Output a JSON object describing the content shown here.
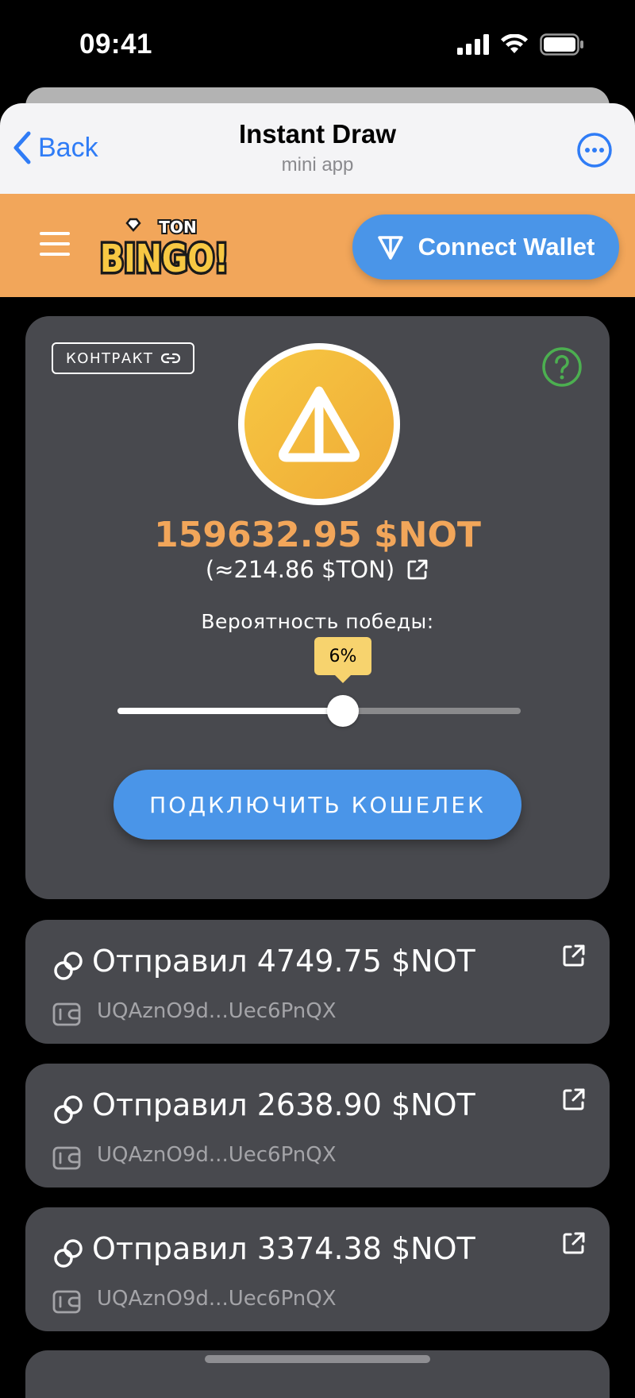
{
  "status_bar": {
    "time": "09:41",
    "icons": [
      "cellular-signal-icon",
      "wifi-icon",
      "battery-icon"
    ]
  },
  "nav": {
    "back_label": "Back",
    "title": "Instant Draw",
    "subtitle": "mini app"
  },
  "header": {
    "logo_top": "TON",
    "logo_main": "BINGO!",
    "connect_wallet_label": "Connect Wallet",
    "background_color": "#f2a65a",
    "button_color": "#4a95e8"
  },
  "draw": {
    "contract_label": "КОНТРАКТ",
    "prize_amount": "159632.95 $NOT",
    "prize_ton": "(≈214.86 $TON)",
    "probability_label": "Вероятность победы:",
    "probability_value": "6%",
    "slider_fraction": 0.56,
    "connect_label": "ПОДКЛЮЧИТЬ КОШЕЛЕК",
    "accent_color": "#f2a65a"
  },
  "transactions": [
    {
      "title": "Отправил 4749.75 $NOT",
      "address": "UQAznO9d...Uec6PnQX"
    },
    {
      "title": "Отправил 2638.90 $NOT",
      "address": "UQAznO9d...Uec6PnQX"
    },
    {
      "title": "Отправил 3374.38 $NOT",
      "address": "UQAznO9d...Uec6PnQX"
    }
  ]
}
